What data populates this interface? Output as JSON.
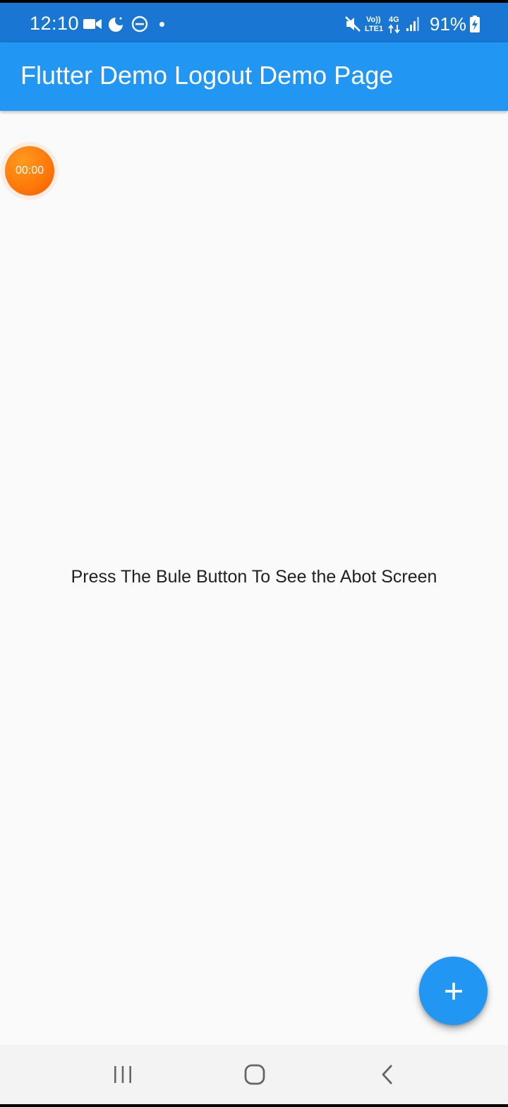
{
  "status_bar": {
    "time": "12:10",
    "network_volte": "Vo))",
    "network_lte": "LTE1",
    "network_4g": "4G",
    "battery_percent": "91%",
    "icons": [
      "video-camera-icon",
      "night-mode-icon",
      "do-not-disturb-icon",
      "notification-dot-icon",
      "mute-icon",
      "volte-icon",
      "data-arrows-icon",
      "signal-icon",
      "battery-charging-icon"
    ]
  },
  "app_bar": {
    "title": "Flutter Demo Logout Demo Page"
  },
  "timer": {
    "label": "00:00"
  },
  "body": {
    "message": "Press The Bule Button To See the Abot Screen"
  },
  "fab": {
    "icon": "plus-icon"
  },
  "nav_bar": {
    "items": [
      "recent-apps-icon",
      "home-icon",
      "back-icon"
    ]
  },
  "colors": {
    "status_bar": "#1976d2",
    "app_bar": "#2196f3",
    "fab": "#2196f3",
    "timer_bubble": "#ff7a0a",
    "background": "#fafafa",
    "nav_bar": "#f3f3f3"
  }
}
